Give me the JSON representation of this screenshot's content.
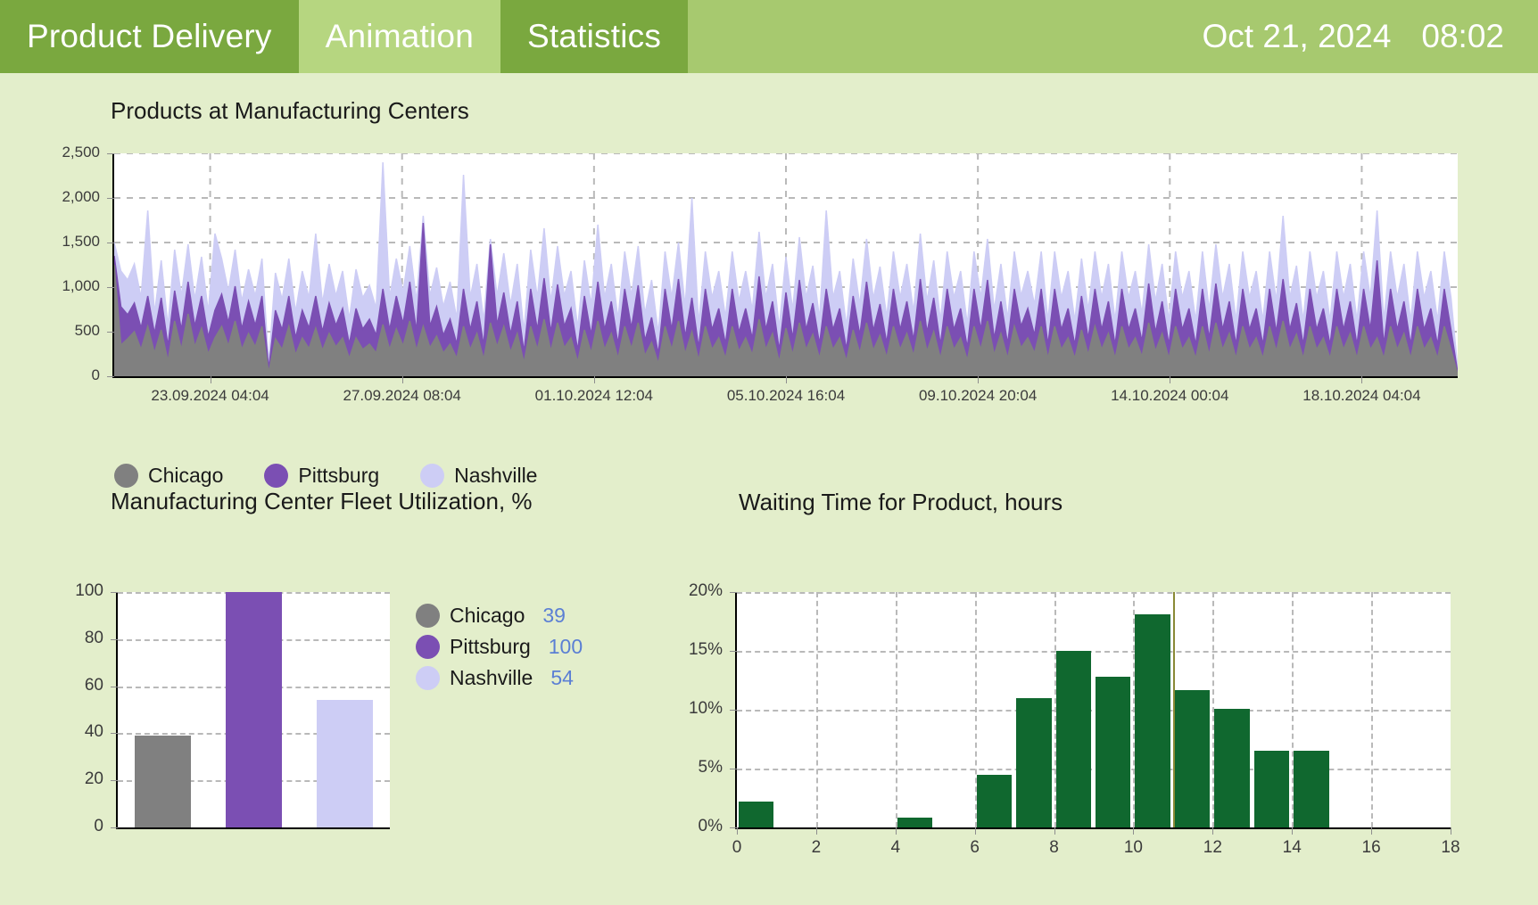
{
  "header": {
    "tabs": [
      {
        "label": "Product Delivery",
        "state": "active"
      },
      {
        "label": "Animation",
        "state": "hover"
      },
      {
        "label": "Statistics",
        "state": "normal"
      }
    ],
    "date": "Oct 21, 2024",
    "time": "08:02",
    "background_color": "#a7c96f",
    "active_tab_color": "#7aa83f",
    "hover_tab_color": "#b6d680"
  },
  "page": {
    "background_color": "#e3eecb"
  },
  "colors": {
    "chicago": "#808080",
    "pittsburg": "#7b4fb3",
    "nashville": "#cdcdf5",
    "histogram_bar": "#10682f",
    "value_text": "#5b7fd4"
  },
  "main_chart": {
    "title": "Products at Manufacturing Centers",
    "legend": [
      {
        "label": "Chicago",
        "color": "#808080"
      },
      {
        "label": "Pittsburg",
        "color": "#7b4fb3"
      },
      {
        "label": "Nashville",
        "color": "#cdcdf5"
      }
    ]
  },
  "utilization_chart": {
    "title": "Manufacturing Center Fleet Utilization, %",
    "legend": [
      {
        "label": "Chicago",
        "value": "39",
        "color": "#808080"
      },
      {
        "label": "Pittsburg",
        "value": "100",
        "color": "#7b4fb3"
      },
      {
        "label": "Nashville",
        "value": "54",
        "color": "#cdcdf5"
      }
    ]
  },
  "waiting_chart": {
    "title": "Waiting Time for Product, hours"
  },
  "chart_data": [
    {
      "type": "area",
      "name": "main-area-chart",
      "title": "Products at Manufacturing Centers",
      "xlabel": "",
      "ylabel": "",
      "ylim": [
        0,
        2500
      ],
      "yticks": [
        0,
        500,
        1000,
        1500,
        2000,
        2500
      ],
      "ytick_labels": [
        "0",
        "500",
        "1,000",
        "1,500",
        "2,000",
        "2,500"
      ],
      "xtick_labels": [
        "23.09.2024 04:04",
        "27.09.2024 08:04",
        "01.10.2024 12:04",
        "05.10.2024 16:04",
        "09.10.2024 20:04",
        "14.10.2024 00:04",
        "18.10.2024 04:04"
      ],
      "grid": true,
      "legend_position": "below",
      "stacked": true,
      "series": [
        {
          "name": "Chicago",
          "color": "#808080",
          "values": [
            1250,
            350,
            420,
            500,
            300,
            560,
            260,
            520,
            170,
            620,
            300,
            700,
            330,
            540,
            250,
            430,
            560,
            340,
            620,
            300,
            480,
            330,
            560,
            40,
            420,
            300,
            560,
            240,
            430,
            310,
            540,
            290,
            480,
            330,
            430,
            200,
            430,
            300,
            360,
            260,
            580,
            300,
            530,
            340,
            620,
            290,
            560,
            320,
            450,
            260,
            360,
            200,
            560,
            300,
            480,
            190,
            600,
            330,
            560,
            270,
            480,
            150,
            560,
            300,
            640,
            280,
            600,
            320,
            430,
            160,
            520,
            260,
            620,
            300,
            480,
            200,
            560,
            310,
            600,
            230,
            380,
            140,
            560,
            300,
            620,
            250,
            500,
            180,
            560,
            300,
            430,
            200,
            560,
            280,
            430,
            240,
            640,
            300,
            480,
            160,
            540,
            240,
            600,
            300,
            470,
            200,
            560,
            300,
            430,
            170,
            520,
            260,
            600,
            290,
            460,
            210,
            560,
            300,
            480,
            230,
            620,
            280,
            500,
            200,
            560,
            300,
            430,
            180,
            560,
            300,
            620,
            240,
            480,
            200,
            560,
            320,
            430,
            260,
            560,
            200,
            560,
            300,
            430,
            200,
            520,
            240,
            560,
            300,
            480,
            200,
            560,
            300,
            430,
            220,
            600,
            280,
            480,
            200,
            560,
            300,
            430,
            200,
            560,
            240,
            600,
            300,
            480,
            200,
            560,
            300,
            430,
            200,
            560,
            280,
            620,
            300,
            470,
            200,
            560,
            300,
            430,
            200,
            560,
            300,
            480,
            200,
            560,
            300,
            430,
            200,
            560,
            300,
            480,
            200,
            560,
            300,
            430,
            200,
            560,
            300,
            20
          ]
        },
        {
          "name": "Pittsburg",
          "color": "#7b4fb3",
          "values": [
            1350,
            780,
            690,
            820,
            540,
            900,
            480,
            880,
            340,
            960,
            520,
            1060,
            560,
            900,
            440,
            740,
            920,
            600,
            1010,
            530,
            840,
            570,
            900,
            80,
            740,
            520,
            900,
            430,
            740,
            540,
            900,
            500,
            820,
            570,
            760,
            360,
            760,
            530,
            640,
            460,
            980,
            520,
            900,
            590,
            1060,
            500,
            1720,
            560,
            780,
            460,
            640,
            360,
            980,
            520,
            840,
            340,
            1480,
            570,
            940,
            470,
            840,
            270,
            980,
            520,
            1100,
            490,
            1030,
            560,
            760,
            290,
            900,
            460,
            1060,
            520,
            840,
            360,
            980,
            540,
            1020,
            400,
            660,
            250,
            980,
            520,
            1090,
            440,
            880,
            320,
            980,
            520,
            760,
            360,
            980,
            490,
            760,
            420,
            1120,
            520,
            840,
            290,
            940,
            420,
            1080,
            520,
            820,
            360,
            980,
            520,
            760,
            300,
            900,
            460,
            1060,
            510,
            810,
            370,
            980,
            520,
            840,
            400,
            1090,
            490,
            880,
            350,
            980,
            520,
            760,
            320,
            980,
            520,
            1080,
            420,
            840,
            360,
            980,
            560,
            760,
            460,
            980,
            350,
            980,
            520,
            760,
            350,
            900,
            420,
            980,
            520,
            840,
            350,
            980,
            520,
            760,
            390,
            1040,
            490,
            840,
            350,
            980,
            520,
            760,
            350,
            980,
            420,
            1040,
            520,
            840,
            350,
            980,
            520,
            760,
            350,
            980,
            490,
            1090,
            520,
            820,
            350,
            980,
            520,
            760,
            350,
            980,
            520,
            840,
            350,
            980,
            520,
            1300,
            350,
            980,
            520,
            840,
            350,
            980,
            520,
            760,
            350,
            980,
            520,
            40
          ]
        },
        {
          "name": "Nashville",
          "color": "#cdcdf5",
          "values": [
            1500,
            1180,
            1080,
            1260,
            880,
            1860,
            700,
            1300,
            560,
            1420,
            900,
            1480,
            860,
            1340,
            720,
            1600,
            1320,
            950,
            1420,
            840,
            1200,
            900,
            1320,
            140,
            1160,
            860,
            1320,
            720,
            1180,
            880,
            1600,
            820,
            1260,
            900,
            1180,
            640,
            1200,
            880,
            1020,
            760,
            2400,
            880,
            1320,
            940,
            1460,
            840,
            1800,
            900,
            1220,
            780,
            1060,
            640,
            2260,
            880,
            1260,
            620,
            1540,
            900,
            1380,
            800,
            1260,
            500,
            1420,
            880,
            1660,
            830,
            1460,
            900,
            1180,
            540,
            1300,
            800,
            1700,
            880,
            1260,
            640,
            1400,
            900,
            1460,
            700,
            1080,
            480,
            1400,
            880,
            1500,
            780,
            2000,
            580,
            1400,
            880,
            1180,
            660,
            1400,
            840,
            1180,
            740,
            1620,
            880,
            1260,
            540,
            1340,
            740,
            1560,
            880,
            1240,
            640,
            1860,
            880,
            1180,
            560,
            1320,
            800,
            1540,
            870,
            1230,
            660,
            1400,
            880,
            1260,
            720,
            1600,
            840,
            1300,
            620,
            1400,
            880,
            1180,
            580,
            1400,
            880,
            1540,
            740,
            1260,
            640,
            1400,
            900,
            1180,
            800,
            1400,
            620,
            1400,
            880,
            1180,
            620,
            1320,
            740,
            1400,
            880,
            1260,
            620,
            1400,
            880,
            1180,
            700,
            1480,
            840,
            1260,
            620,
            1400,
            880,
            1180,
            620,
            1400,
            740,
            1480,
            880,
            1260,
            620,
            1400,
            880,
            1180,
            620,
            1400,
            840,
            1800,
            880,
            1240,
            620,
            1400,
            880,
            1180,
            620,
            1400,
            880,
            1260,
            620,
            1400,
            880,
            1860,
            620,
            1400,
            880,
            1260,
            620,
            1400,
            880,
            1180,
            620,
            1400,
            880,
            80
          ]
        }
      ]
    },
    {
      "type": "bar",
      "name": "utilization-bar-chart",
      "title": "Manufacturing Center Fleet Utilization, %",
      "categories": [
        "Chicago",
        "Pittsburg",
        "Nashville"
      ],
      "values": [
        39,
        100,
        54
      ],
      "colors": [
        "#808080",
        "#7b4fb3",
        "#cdcdf5"
      ],
      "xlabel": "",
      "ylabel": "",
      "ylim": [
        0,
        100
      ],
      "yticks": [
        0,
        20,
        40,
        60,
        80,
        100
      ],
      "ytick_labels": [
        "0",
        "20",
        "40",
        "60",
        "80",
        "100"
      ],
      "grid": true,
      "legend_position": "right"
    },
    {
      "type": "bar",
      "name": "waiting-time-histogram",
      "title": "Waiting Time for Product, hours",
      "xlabel": "",
      "ylabel": "",
      "xlim": [
        0,
        18
      ],
      "ylim": [
        0,
        20
      ],
      "xticks": [
        0,
        2,
        4,
        6,
        8,
        10,
        12,
        14,
        16,
        18
      ],
      "xtick_labels": [
        "0",
        "2",
        "4",
        "6",
        "8",
        "10",
        "12",
        "14",
        "16",
        "18"
      ],
      "yticks": [
        0,
        5,
        10,
        15,
        20
      ],
      "ytick_labels": [
        "0%",
        "5%",
        "10%",
        "15%",
        "20%"
      ],
      "grid": true,
      "bar_color": "#10682f",
      "bin_width": 1,
      "bins": [
        {
          "x0": 0,
          "x1": 1,
          "value": 2.2
        },
        {
          "x0": 1,
          "x1": 2,
          "value": 0
        },
        {
          "x0": 2,
          "x1": 3,
          "value": 0
        },
        {
          "x0": 3,
          "x1": 4,
          "value": 0
        },
        {
          "x0": 4,
          "x1": 5,
          "value": 0.8
        },
        {
          "x0": 5,
          "x1": 6,
          "value": 0
        },
        {
          "x0": 6,
          "x1": 7,
          "value": 4.5
        },
        {
          "x0": 7,
          "x1": 8,
          "value": 11.0
        },
        {
          "x0": 8,
          "x1": 9,
          "value": 15.0
        },
        {
          "x0": 9,
          "x1": 10,
          "value": 12.8
        },
        {
          "x0": 10,
          "x1": 11,
          "value": 18.1
        },
        {
          "x0": 11,
          "x1": 12,
          "value": 11.7
        },
        {
          "x0": 12,
          "x1": 13,
          "value": 10.1
        },
        {
          "x0": 13,
          "x1": 14,
          "value": 6.5
        },
        {
          "x0": 14,
          "x1": 15,
          "value": 6.5
        },
        {
          "x0": 15,
          "x1": 16,
          "value": 0
        },
        {
          "x0": 16,
          "x1": 17,
          "value": 0
        },
        {
          "x0": 17,
          "x1": 18,
          "value": 0
        }
      ],
      "marker_x": 11,
      "marker_color": "#8a8a35"
    }
  ]
}
